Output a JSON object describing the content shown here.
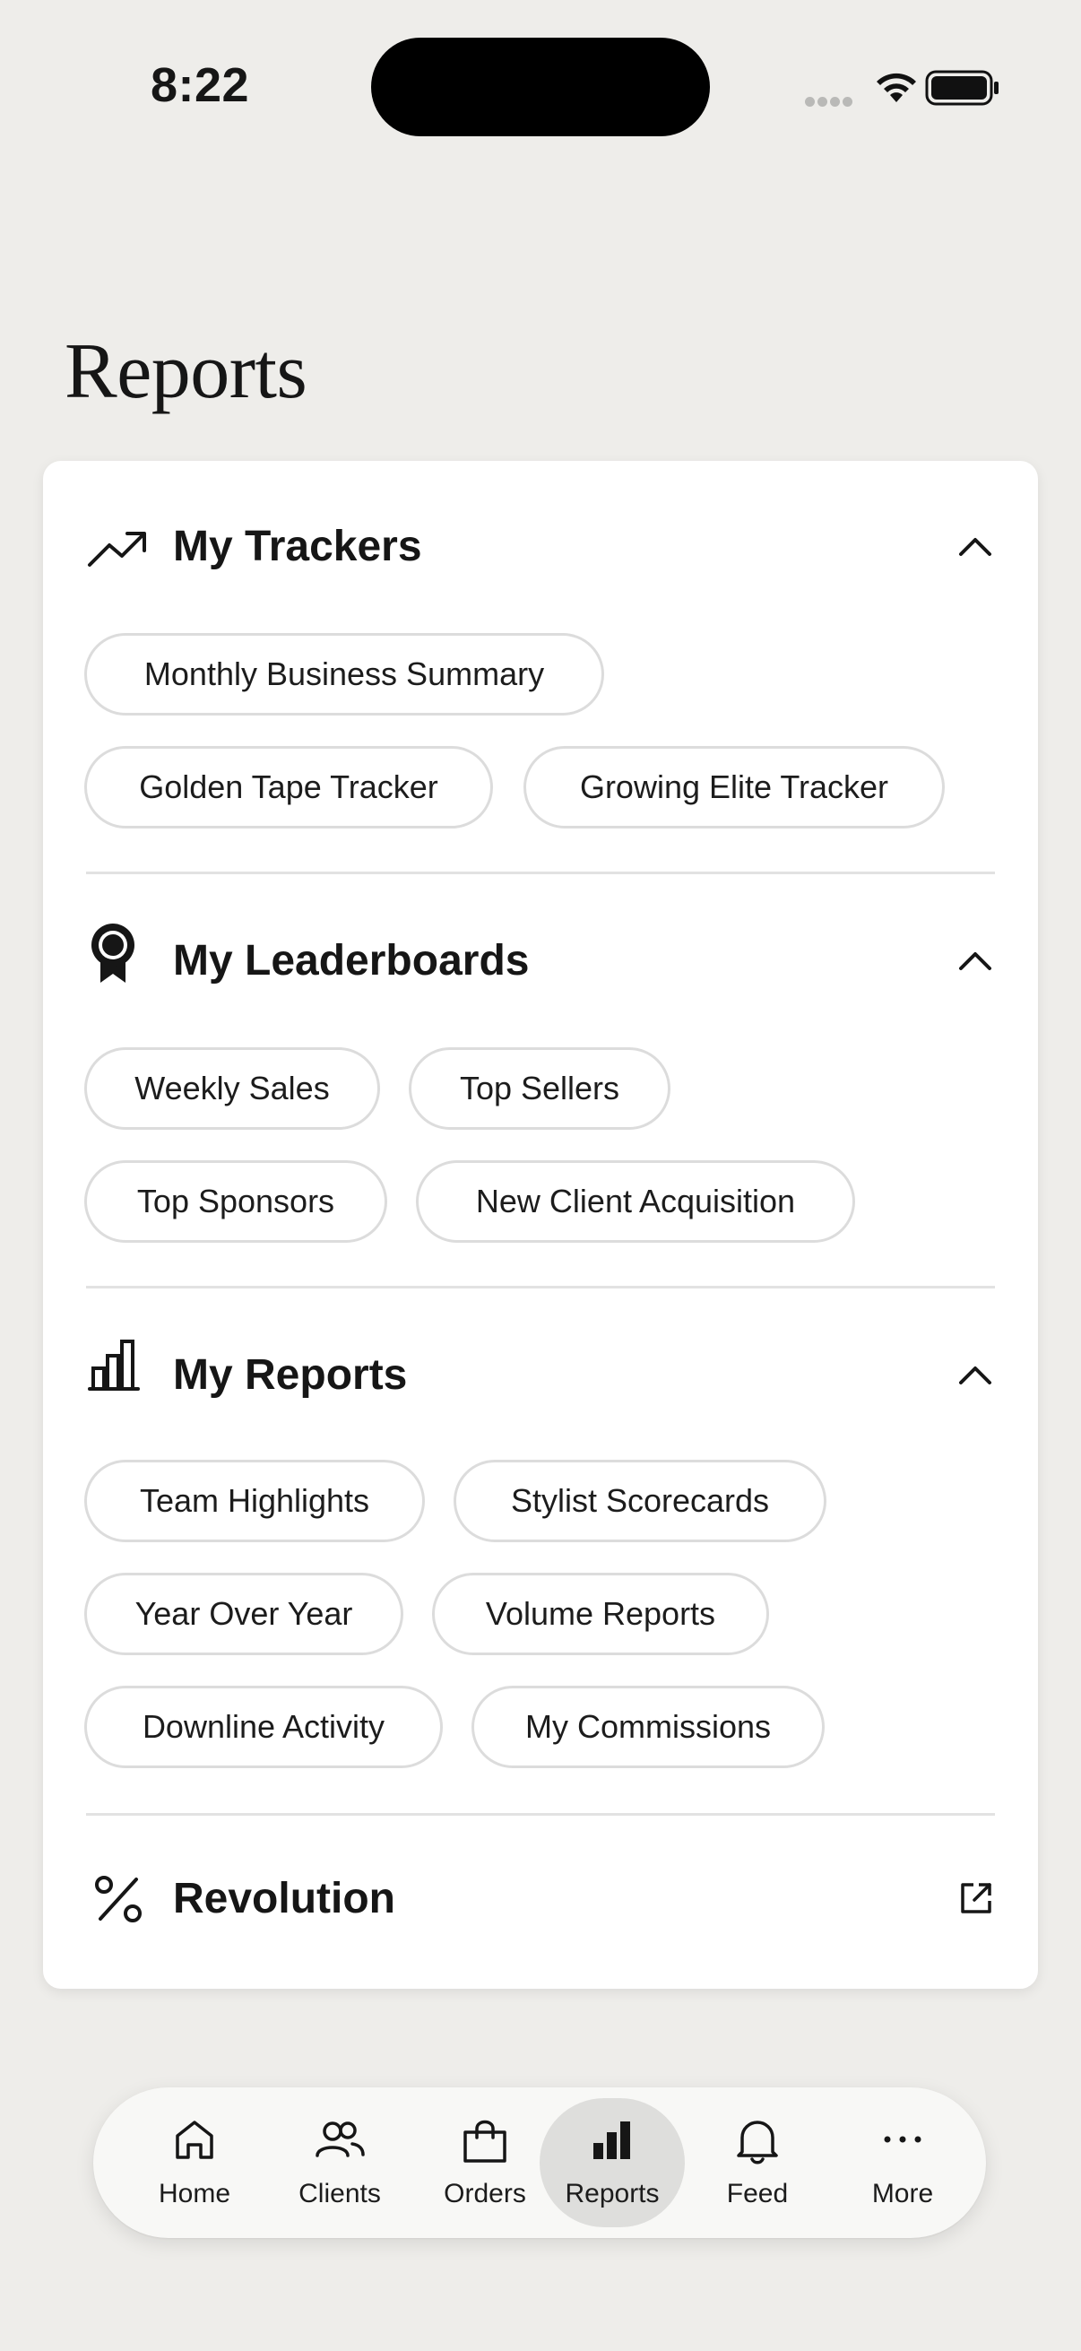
{
  "status_bar": {
    "time": "8:22"
  },
  "page": {
    "title": "Reports"
  },
  "sections": {
    "trackers": {
      "title": "My Trackers",
      "icon": "trending-up-icon",
      "chips": [
        "Monthly Business Summary",
        "Golden Tape Tracker",
        "Growing Elite Tracker"
      ]
    },
    "leaderboards": {
      "title": "My Leaderboards",
      "icon": "award-ribbon-icon",
      "chips": [
        "Weekly Sales",
        "Top Sellers",
        "Top Sponsors",
        "New Client Acquisition"
      ]
    },
    "reports": {
      "title": "My Reports",
      "icon": "bar-chart-icon",
      "chips": [
        "Team Highlights",
        "Stylist Scorecards",
        "Year Over Year",
        "Volume Reports",
        "Downline Activity",
        "My Commissions"
      ]
    },
    "revolution": {
      "title": "Revolution",
      "icon": "percent-icon",
      "action_icon": "external-link-icon"
    }
  },
  "nav": {
    "items": [
      {
        "label": "Home",
        "icon": "home-icon"
      },
      {
        "label": "Clients",
        "icon": "users-icon"
      },
      {
        "label": "Orders",
        "icon": "shopping-bag-icon"
      },
      {
        "label": "Reports",
        "icon": "bar-chart-icon",
        "active": true
      },
      {
        "label": "Feed",
        "icon": "bell-icon"
      },
      {
        "label": "More",
        "icon": "more-icon"
      }
    ]
  },
  "colors": {
    "background": "#eeedea",
    "card": "#ffffff",
    "chip_border": "#dcdcdc",
    "nav_active": "#dededc",
    "text": "#161616"
  }
}
